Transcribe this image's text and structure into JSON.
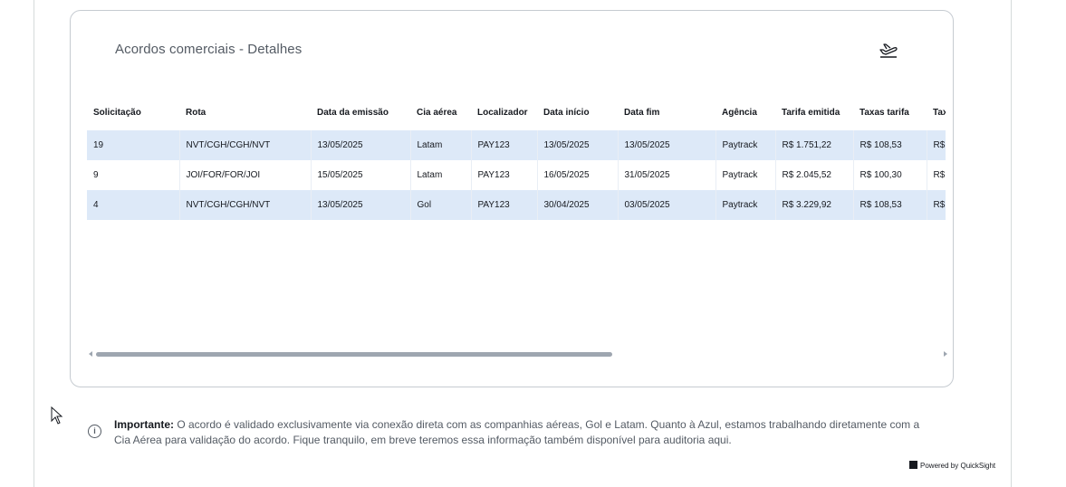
{
  "card": {
    "title": "Acordos comerciais - Detalhes",
    "icon": "airplane-takeoff-icon"
  },
  "table": {
    "columns": [
      "Solicitação",
      "Rota",
      "Data da emissão",
      "Cia aérea",
      "Localizador",
      "Data início",
      "Data fim",
      "Agência",
      "Tarifa emitida",
      "Taxas tarifa",
      "Tax"
    ],
    "rows": [
      [
        "19",
        "NVT/CGH/CGH/NVT",
        "13/05/2025",
        "Latam",
        "PAY123",
        "13/05/2025",
        "13/05/2025",
        "Paytrack",
        "R$ 1.751,22",
        "R$ 108,53",
        "R$ ("
      ],
      [
        "9",
        "JOI/FOR/FOR/JOI",
        "15/05/2025",
        "Latam",
        "PAY123",
        "16/05/2025",
        "31/05/2025",
        "Paytrack",
        "R$ 2.045,52",
        "R$ 100,30",
        "R$ ("
      ],
      [
        "4",
        "NVT/CGH/CGH/NVT",
        "13/05/2025",
        "Gol",
        "PAY123",
        "30/04/2025",
        "03/05/2025",
        "Paytrack",
        "R$ 3.229,92",
        "R$ 108,53",
        "R$ ("
      ]
    ]
  },
  "notice": {
    "icon": "info-icon",
    "icon_glyph": "i",
    "label": "Importante:",
    "text": " O acordo é validado exclusivamente via conexão direta com as companhias aéreas, Gol e Latam. Quanto à Azul, estamos trabalhando diretamente com a Cia Aérea para validação do acordo. Fique tranquilo, em breve teremos essa informação também disponível para auditoria aqui."
  },
  "footer": {
    "powered_by": "Powered by QuickSight"
  },
  "colors": {
    "row_highlight": "#dde9f8",
    "text_primary": "#16191f",
    "text_secondary": "#545b64",
    "scrollbar": "#9ea6b0"
  }
}
